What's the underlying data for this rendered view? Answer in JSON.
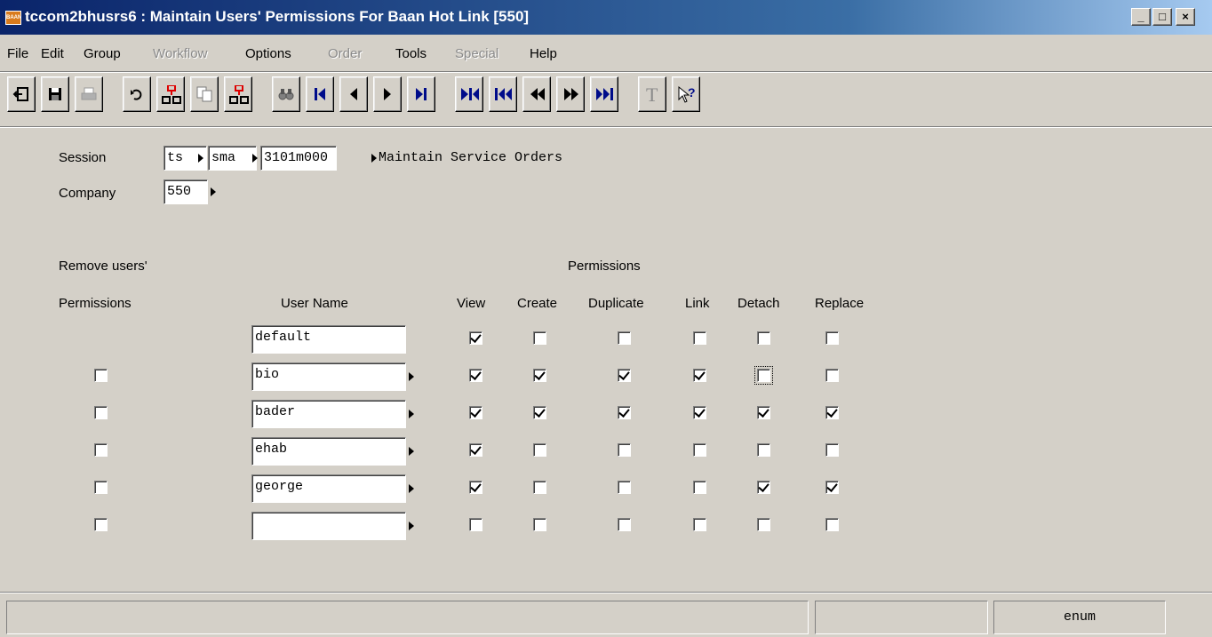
{
  "window": {
    "title": "tccom2bhusrs6 : Maintain Users' Permissions For Baan Hot Link [550]",
    "app_icon_text": "BAAN",
    "minimize": "_",
    "maximize": "□",
    "close": "×"
  },
  "menu": [
    {
      "label": "File",
      "enabled": true
    },
    {
      "label": "Edit",
      "enabled": true
    },
    {
      "label": "Group",
      "enabled": true
    },
    {
      "label": "Workflow",
      "enabled": false
    },
    {
      "label": "Options",
      "enabled": true
    },
    {
      "label": "Order",
      "enabled": false
    },
    {
      "label": "Tools",
      "enabled": true
    },
    {
      "label": "Special",
      "enabled": false
    },
    {
      "label": "Help",
      "enabled": true
    }
  ],
  "toolbar": {
    "icons": [
      "exit-icon",
      "save-icon",
      "print-icon",
      "undo-icon",
      "insert-record-icon",
      "duplicate-record-icon",
      "delete-record-icon",
      "find-icon",
      "first-record-icon",
      "previous-record-icon",
      "next-record-icon",
      "last-record-icon",
      "first-set-icon",
      "previous-set-icon",
      "rewind-icon",
      "fast-forward-icon",
      "last-set-icon",
      "text-icon",
      "context-help-icon"
    ]
  },
  "form": {
    "session_label": "Session",
    "session_package": "ts",
    "session_module": "sma",
    "session_code": "3101m000",
    "session_description": "Maintain Service Orders",
    "company_label": "Company",
    "company_value": "550",
    "remove_header_1": "Remove users'",
    "remove_header_2": "Permissions",
    "user_name_header": "User Name",
    "permissions_header": "Permissions",
    "columns": [
      "View",
      "Create",
      "Duplicate",
      "Link",
      "Detach",
      "Replace"
    ]
  },
  "rows": [
    {
      "remove": null,
      "user": "default",
      "view": true,
      "create": false,
      "duplicate": false,
      "link": false,
      "detach": false,
      "replace": false
    },
    {
      "remove": false,
      "user": "bio",
      "view": true,
      "create": true,
      "duplicate": true,
      "link": true,
      "detach": false,
      "replace": false
    },
    {
      "remove": false,
      "user": "bader",
      "view": true,
      "create": true,
      "duplicate": true,
      "link": true,
      "detach": true,
      "replace": true
    },
    {
      "remove": false,
      "user": "ehab",
      "view": true,
      "create": false,
      "duplicate": false,
      "link": false,
      "detach": false,
      "replace": false
    },
    {
      "remove": false,
      "user": "george",
      "view": true,
      "create": false,
      "duplicate": false,
      "link": false,
      "detach": true,
      "replace": true
    },
    {
      "remove": false,
      "user": "",
      "view": false,
      "create": false,
      "duplicate": false,
      "link": false,
      "detach": false,
      "replace": false
    }
  ],
  "focused_cell": {
    "row": 1,
    "column": "detach"
  },
  "status_bar": {
    "message": "",
    "middle": "",
    "right": "enum"
  }
}
